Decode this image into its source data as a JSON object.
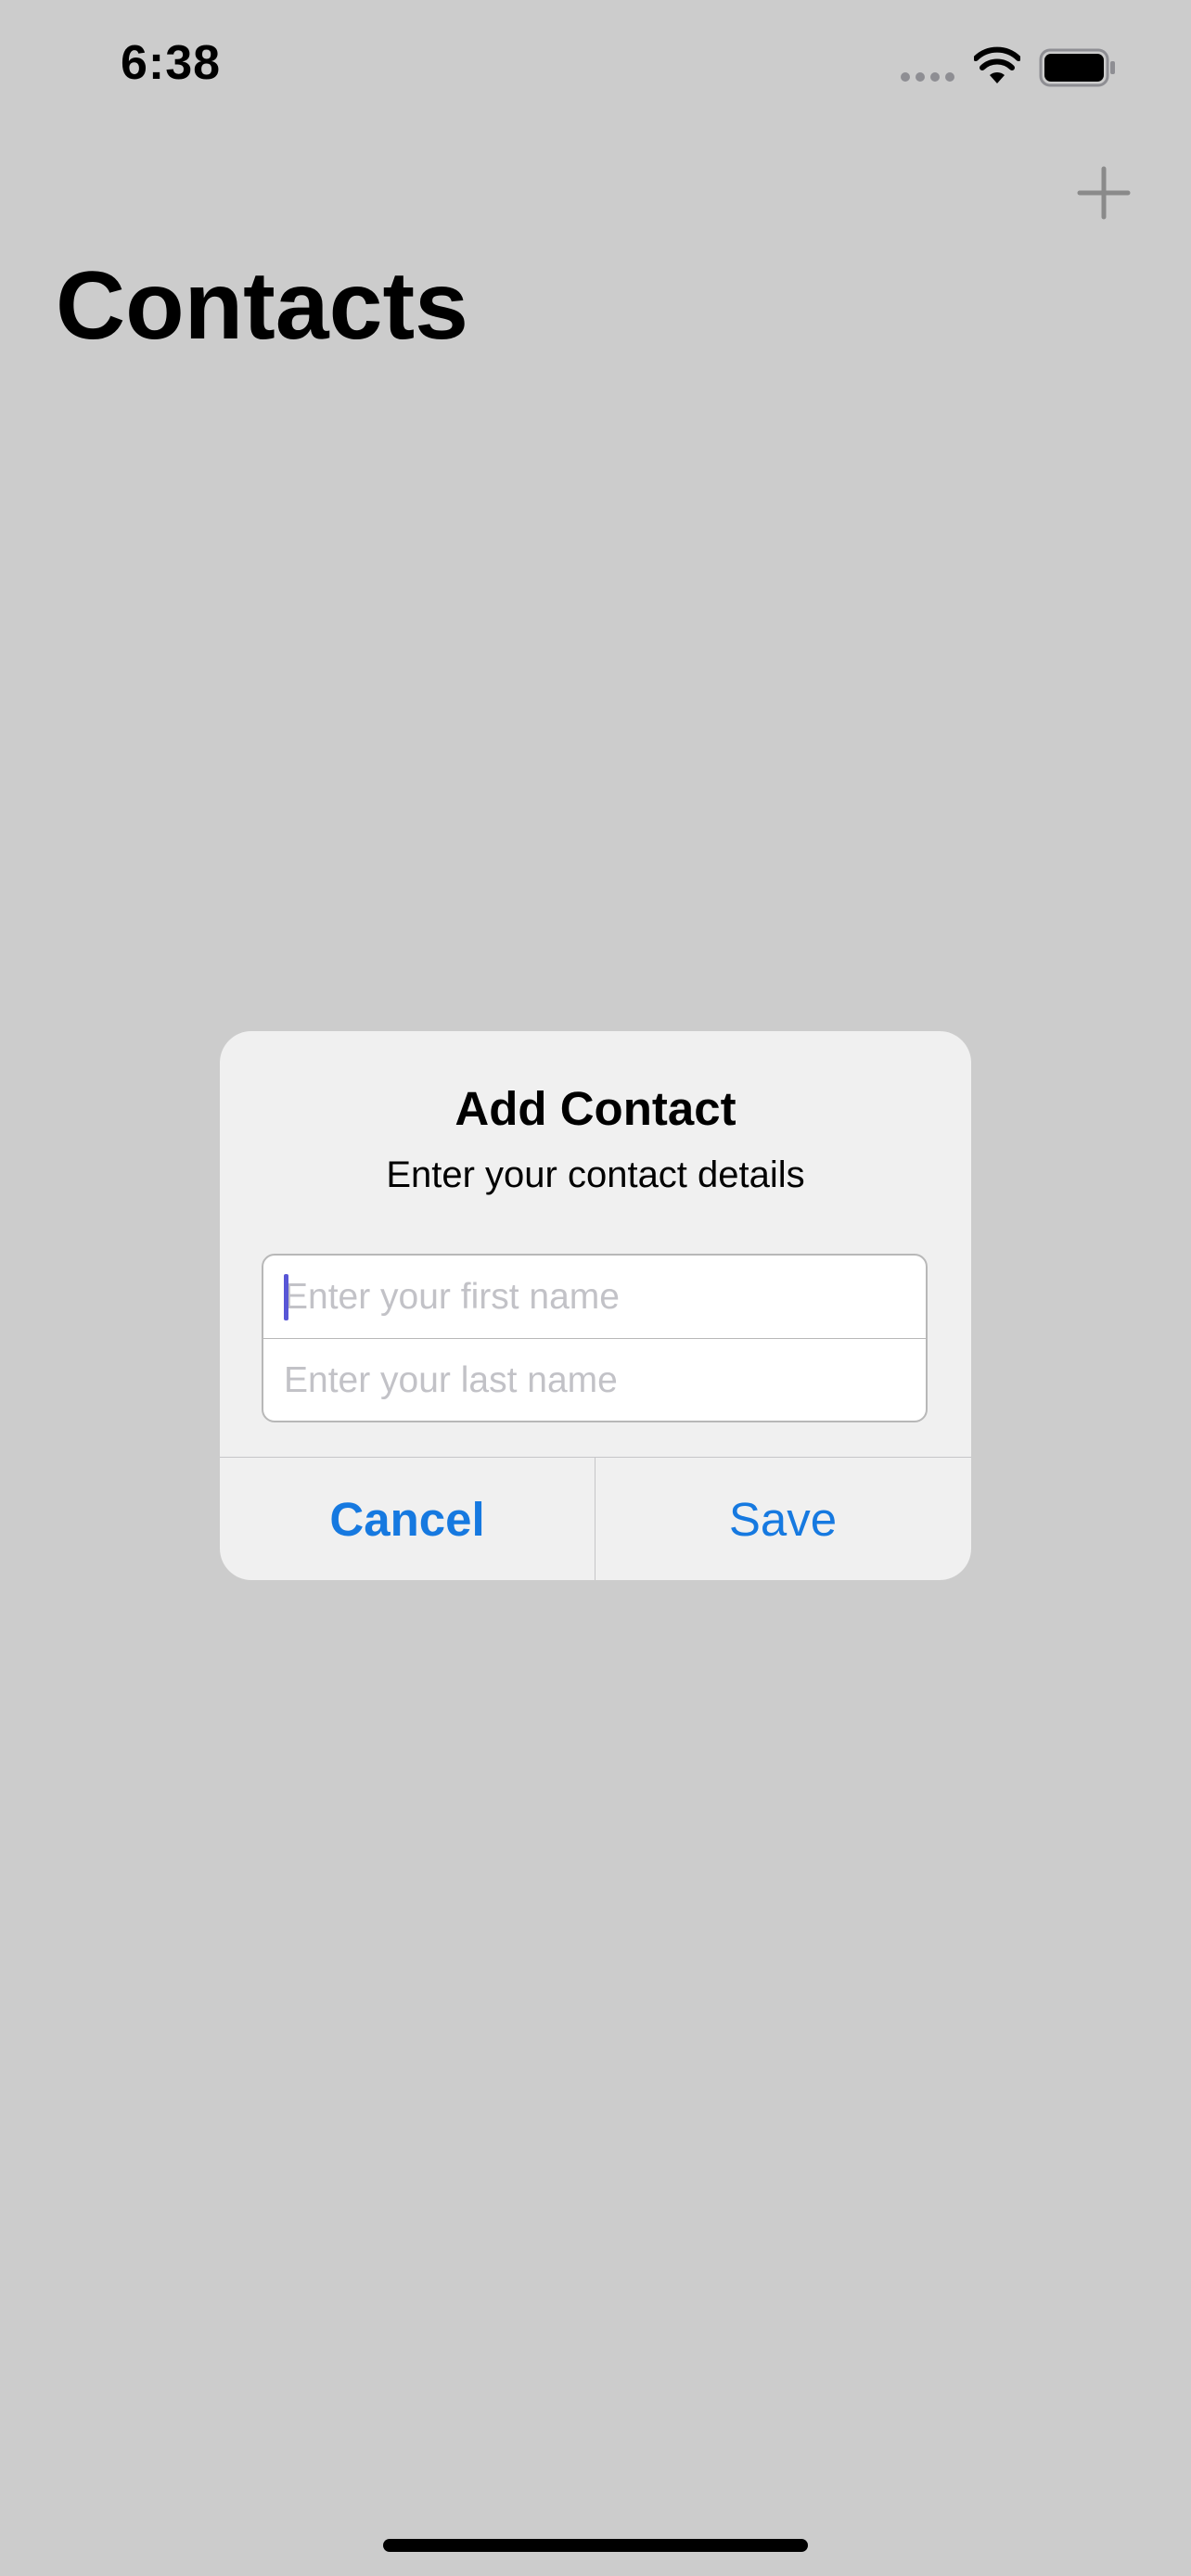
{
  "status_bar": {
    "time": "6:38",
    "signal_icon": "cellular-signal-icon",
    "wifi_icon": "wifi-icon",
    "battery_icon": "battery-icon"
  },
  "nav": {
    "add_icon": "plus-icon",
    "title": "Contacts"
  },
  "dialog": {
    "title": "Add Contact",
    "subtitle": "Enter your contact details",
    "first_name_placeholder": "Enter your first name",
    "last_name_placeholder": "Enter your last name",
    "cancel_label": "Cancel",
    "save_label": "Save",
    "accent_color": "#1679e0"
  }
}
